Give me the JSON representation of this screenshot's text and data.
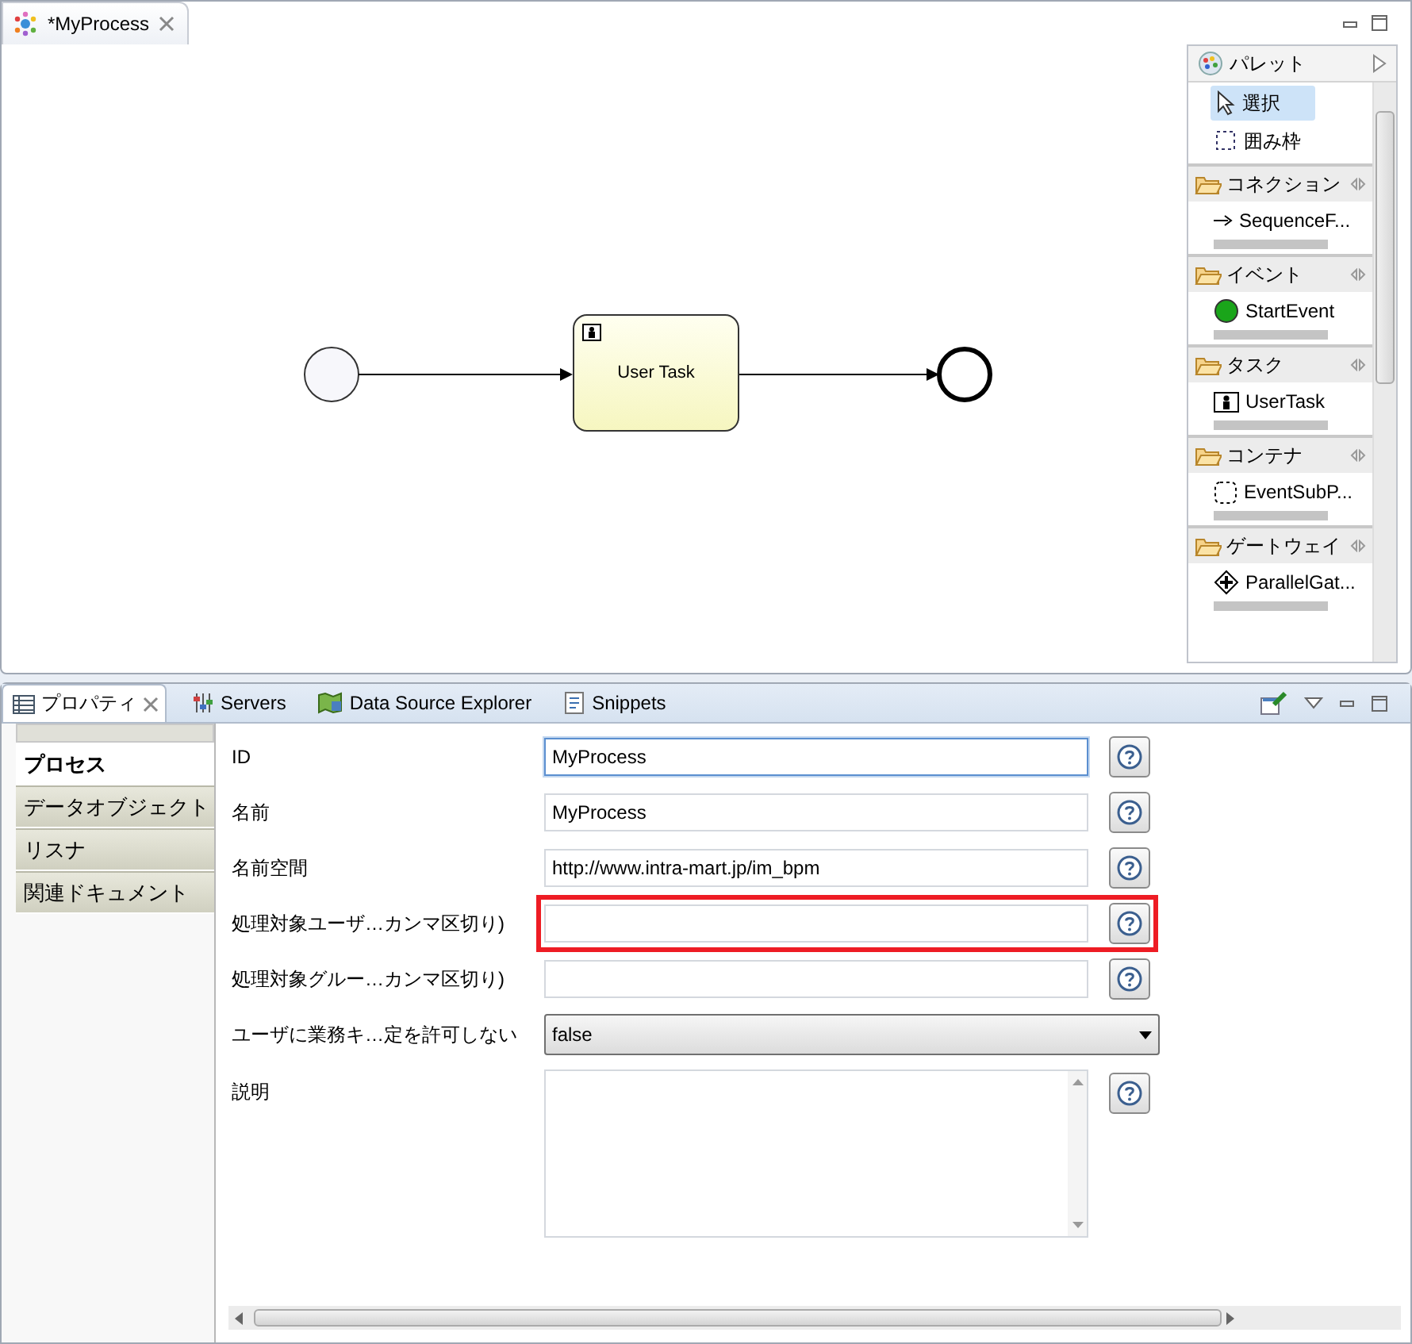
{
  "editor": {
    "tab": {
      "title": "*MyProcess",
      "selected": true
    },
    "diagram": {
      "task": {
        "label": "User Task"
      }
    },
    "palette": {
      "title": "パレット",
      "tools": [
        {
          "label": "選択",
          "kind": "select",
          "selected": true
        },
        {
          "label": "囲み枠",
          "kind": "marquee",
          "selected": false
        }
      ],
      "drawers": [
        {
          "label": "コネクション",
          "items": [
            {
              "label": "SequenceF...",
              "kind": "arrow"
            }
          ]
        },
        {
          "label": "イベント",
          "items": [
            {
              "label": "StartEvent",
              "kind": "start"
            }
          ]
        },
        {
          "label": "タスク",
          "items": [
            {
              "label": "UserTask",
              "kind": "usertask"
            }
          ]
        },
        {
          "label": "コンテナ",
          "items": [
            {
              "label": "EventSubP...",
              "kind": "subprocess"
            }
          ]
        },
        {
          "label": "ゲートウェイ",
          "items": [
            {
              "label": "ParallelGat...",
              "kind": "gateway"
            }
          ]
        }
      ]
    }
  },
  "properties": {
    "tabs": [
      {
        "label": "プロパティ",
        "kind": "properties",
        "selected": true
      },
      {
        "label": "Servers",
        "kind": "servers",
        "selected": false
      },
      {
        "label": "Data Source Explorer",
        "kind": "datasource",
        "selected": false
      },
      {
        "label": "Snippets",
        "kind": "snippets",
        "selected": false
      }
    ],
    "sections": [
      {
        "label": "プロセス",
        "selected": true
      },
      {
        "label": "データオブジェクト",
        "selected": false
      },
      {
        "label": "リスナ",
        "selected": false
      },
      {
        "label": "関連ドキュメント",
        "selected": false
      }
    ],
    "fields": [
      {
        "label": "ID",
        "kind": "text",
        "value": "MyProcess",
        "focused": true,
        "highlighted": false
      },
      {
        "label": "名前",
        "kind": "text",
        "value": "MyProcess",
        "focused": false,
        "highlighted": false
      },
      {
        "label": "名前空間",
        "kind": "text",
        "value": "http://www.intra-mart.jp/im_bpm",
        "focused": false,
        "highlighted": false
      },
      {
        "label": "処理対象ユーザ…カンマ区切り)",
        "kind": "text",
        "focused": false,
        "highlighted": true
      },
      {
        "label": "処理対象グルー…カンマ区切り)",
        "kind": "text",
        "focused": false,
        "highlighted": false
      },
      {
        "label": "ユーザに業務キ…定を許可しない",
        "kind": "select",
        "value": "false",
        "highlighted": false
      },
      {
        "label": "説明",
        "kind": "textarea",
        "focused": false,
        "highlighted": false
      }
    ]
  }
}
